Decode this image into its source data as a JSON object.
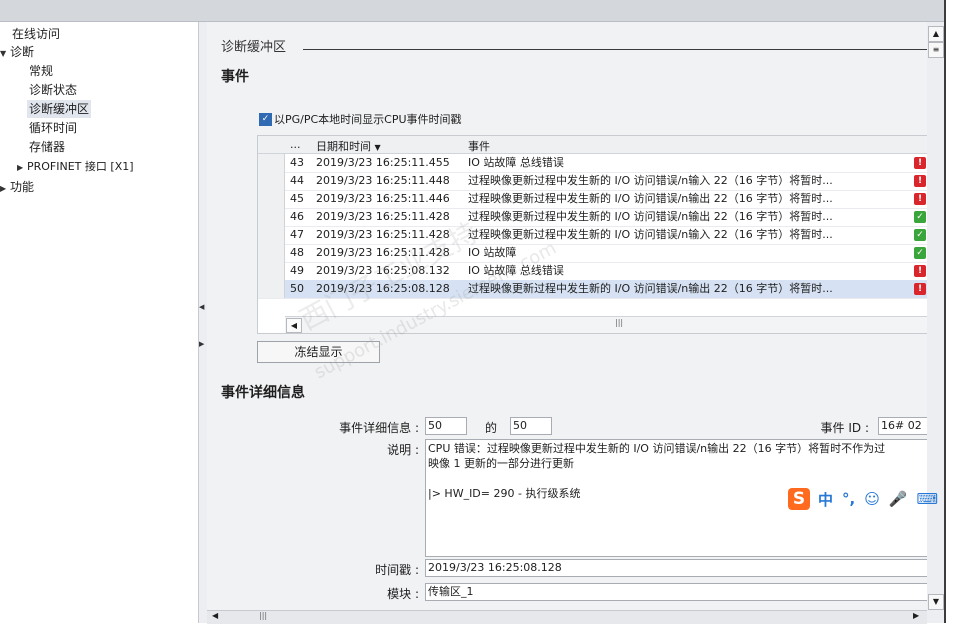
{
  "nav": {
    "items": [
      {
        "label": "在线访问",
        "indent": 0,
        "arrow": ""
      },
      {
        "label": "诊断",
        "indent": 0,
        "arrow": "▼"
      },
      {
        "label": "常规",
        "indent": 1,
        "arrow": ""
      },
      {
        "label": "诊断状态",
        "indent": 1,
        "arrow": ""
      },
      {
        "label": "诊断缓冲区",
        "indent": 1,
        "arrow": "",
        "selected": true
      },
      {
        "label": "循环时间",
        "indent": 1,
        "arrow": ""
      },
      {
        "label": "存储器",
        "indent": 1,
        "arrow": ""
      },
      {
        "label": "PROFINET 接口 [X1]",
        "indent": 1,
        "arrow": "▶"
      },
      {
        "label": "功能",
        "indent": 0,
        "arrow": "▶"
      }
    ]
  },
  "main": {
    "section_title": "诊断缓冲区",
    "events_heading": "事件",
    "checkbox_label": "以PG/PC本地时间显示CPU事件时间戳",
    "checkbox_checked": true,
    "table": {
      "col_no": "...",
      "col_datetime": "日期和时间",
      "col_event": "事件",
      "rows": [
        {
          "no": "43",
          "datetime": "2019/3/23 16:25:11.455",
          "event": "IO 站故障 总线错误",
          "status": "error"
        },
        {
          "no": "44",
          "datetime": "2019/3/23 16:25:11.448",
          "event": "过程映像更新过程中发生新的 I/O 访问错误/n输入 22（16 字节）将暂时...",
          "status": "error"
        },
        {
          "no": "45",
          "datetime": "2019/3/23 16:25:11.446",
          "event": "过程映像更新过程中发生新的 I/O 访问错误/n输出 22（16 字节）将暂时...",
          "status": "error"
        },
        {
          "no": "46",
          "datetime": "2019/3/23 16:25:11.428",
          "event": "过程映像更新过程中发生新的 I/O 访问错误/n输出 22（16 字节）将暂时...",
          "status": "ok"
        },
        {
          "no": "47",
          "datetime": "2019/3/23 16:25:11.428",
          "event": "过程映像更新过程中发生新的 I/O 访问错误/n输入 22（16 字节）将暂时...",
          "status": "ok"
        },
        {
          "no": "48",
          "datetime": "2019/3/23 16:25:11.428",
          "event": "IO 站故障",
          "status": "ok"
        },
        {
          "no": "49",
          "datetime": "2019/3/23 16:25:08.132",
          "event": "IO 站故障 总线错误",
          "status": "error"
        },
        {
          "no": "50",
          "datetime": "2019/3/23 16:25:08.128",
          "event": "过程映像更新过程中发生新的 I/O 访问错误/n输出 22（16 字节）将暂时...",
          "status": "error",
          "selected": true
        }
      ]
    },
    "freeze_button": "冻结显示",
    "detail_heading": "事件详细信息",
    "detail": {
      "info_label": "事件详细信息 :",
      "info_value": "50",
      "of_label": "的",
      "of_value": "50",
      "event_id_label": "事件 ID :",
      "event_id_value": "16# 02",
      "desc_label": "说明 :",
      "desc_line1": "CPU 错误：过程映像更新过程中发生新的 I/O 访问错误/n输出 22（16 字节）将暂时不作为过",
      "desc_line2": "映像 1 更新的一部分进行更新",
      "desc_line3": "|> HW_ID=  290 - 执行级系统",
      "timestamp_label": "时间戳 :",
      "timestamp_value": "2019/3/23 16:25:08.128",
      "module_label": "模块 :",
      "module_value": "传输区_1"
    }
  },
  "watermark": {
    "line1": "西门子工业支持",
    "line2": "support.industry.siemens.com"
  },
  "ime": {
    "logo": "S",
    "lang": "中",
    "punct": "°,",
    "emoji": "☺",
    "mic": "🎤",
    "keyboard": "⌨"
  },
  "colors": {
    "error": "#d9262c",
    "ok": "#3aa53a",
    "selected_row": "#d6e2f3",
    "accent": "#2f6ab3"
  }
}
